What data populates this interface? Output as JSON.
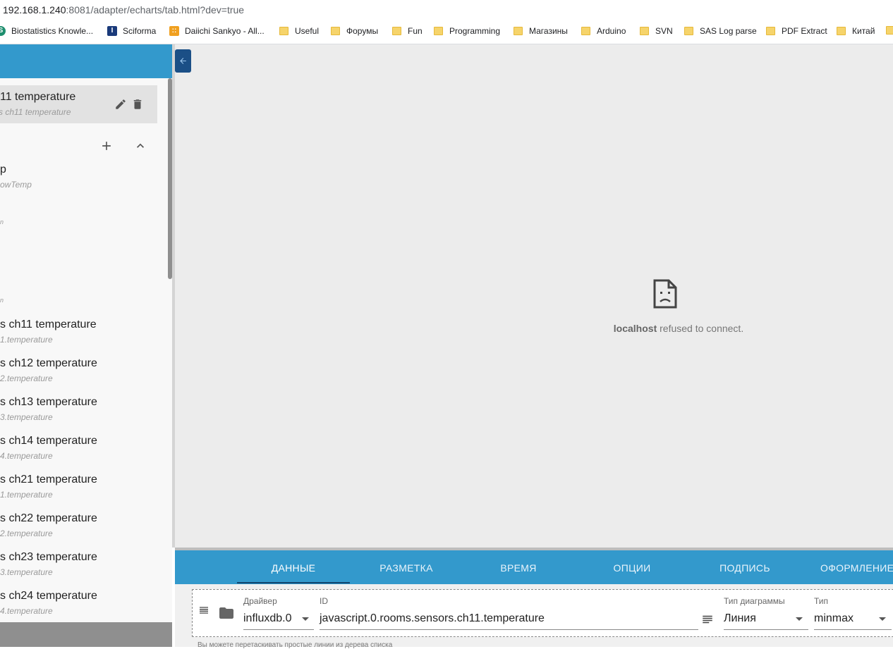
{
  "browser": {
    "url_host": "192.168.1.240",
    "url_rest": ":8081/adapter/echarts/tab.html?dev=true",
    "bookmarks": [
      {
        "label": "Biostatistics Knowle...",
        "icon": "s-icon"
      },
      {
        "label": "Sciforma",
        "icon": "i-icon"
      },
      {
        "label": "Daiichi Sankyo - All...",
        "icon": "grid-icon"
      },
      {
        "label": "Useful",
        "icon": "folder-icon"
      },
      {
        "label": "Форумы",
        "icon": "folder-icon"
      },
      {
        "label": "Fun",
        "icon": "folder-icon"
      },
      {
        "label": "Programming",
        "icon": "folder-icon"
      },
      {
        "label": "Магазины",
        "icon": "folder-icon"
      },
      {
        "label": "Arduino",
        "icon": "folder-icon"
      },
      {
        "label": "SVN",
        "icon": "folder-icon"
      },
      {
        "label": "SAS Log parse",
        "icon": "folder-icon"
      },
      {
        "label": "PDF Extract",
        "icon": "folder-icon"
      },
      {
        "label": "Китай",
        "icon": "folder-icon"
      }
    ]
  },
  "sidebar": {
    "selected": {
      "title": "11 temperature",
      "subtitle": "s ch11 temperature"
    },
    "folder": {
      "title": "p",
      "subtitle": "owTemp",
      "stray1": "n",
      "stray2": "n"
    },
    "items": [
      {
        "title": "s ch11 temperature",
        "subtitle": "1.temperature"
      },
      {
        "title": "s ch12 temperature",
        "subtitle": "2.temperature"
      },
      {
        "title": "s ch13 temperature",
        "subtitle": "3.temperature"
      },
      {
        "title": "s ch14 temperature",
        "subtitle": "4.temperature"
      },
      {
        "title": "s ch21 temperature",
        "subtitle": "1.temperature"
      },
      {
        "title": "s ch22 temperature",
        "subtitle": "2.temperature"
      },
      {
        "title": "s ch23 temperature",
        "subtitle": "3.temperature"
      },
      {
        "title": "s ch24 temperature",
        "subtitle": "4.temperature"
      }
    ]
  },
  "preview": {
    "error_host": "localhost",
    "error_rest": " refused to connect."
  },
  "tabs": [
    {
      "label": "ДАННЫЕ",
      "active": true
    },
    {
      "label": "РАЗМЕТКА",
      "active": false
    },
    {
      "label": "ВРЕМЯ",
      "active": false
    },
    {
      "label": "ОПЦИИ",
      "active": false
    },
    {
      "label": "ПОДПИСЬ",
      "active": false
    },
    {
      "label": "ОФОРМЛЕНИЕ",
      "active": false
    }
  ],
  "line_editor": {
    "driver_label": "Драйвер",
    "driver_value": "influxdb.0",
    "id_label": "ID",
    "id_value": "javascript.0.rooms.sensors.ch11.temperature",
    "chart_type_label": "Тип диаграммы",
    "chart_type_value": "Линия",
    "type_label": "Тип",
    "type_value": "minmax",
    "hint": "Вы можете перетаскивать простые линии из дерева списка"
  },
  "colors": {
    "accent": "#3399cc",
    "dark_accent": "#1b4f86",
    "background": "#ececec"
  }
}
